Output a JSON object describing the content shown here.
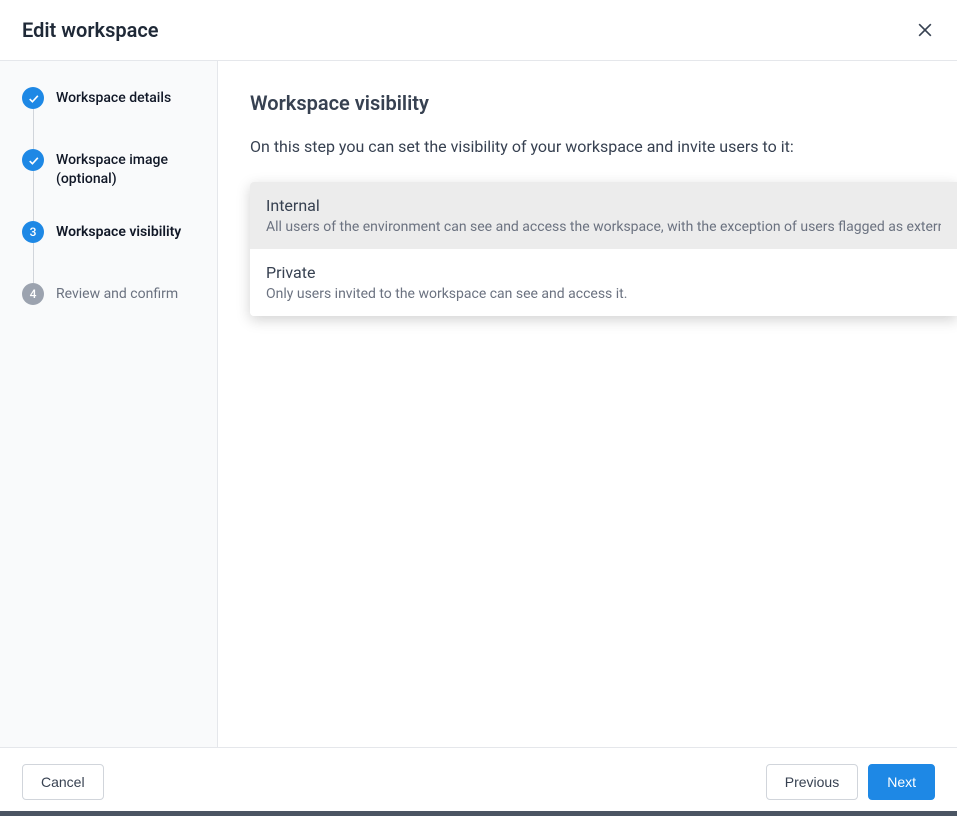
{
  "header": {
    "title": "Edit workspace"
  },
  "steps": [
    {
      "label": "Workspace details",
      "state": "done"
    },
    {
      "label": "Workspace image (optional)",
      "state": "done"
    },
    {
      "label": "Workspace visibility",
      "state": "current",
      "number": "3"
    },
    {
      "label": "Review and confirm",
      "state": "pending",
      "number": "4"
    }
  ],
  "main": {
    "title": "Workspace visibility",
    "description": "On this step you can set the visibility of your workspace and invite users to it:"
  },
  "options": [
    {
      "title": "Internal",
      "description": "All users of the environment can see and access the workspace, with the exception of users flagged as extern",
      "selected": true
    },
    {
      "title": "Private",
      "description": "Only users invited to the workspace can see and access it.",
      "selected": false
    }
  ],
  "footer": {
    "cancel": "Cancel",
    "previous": "Previous",
    "next": "Next"
  }
}
